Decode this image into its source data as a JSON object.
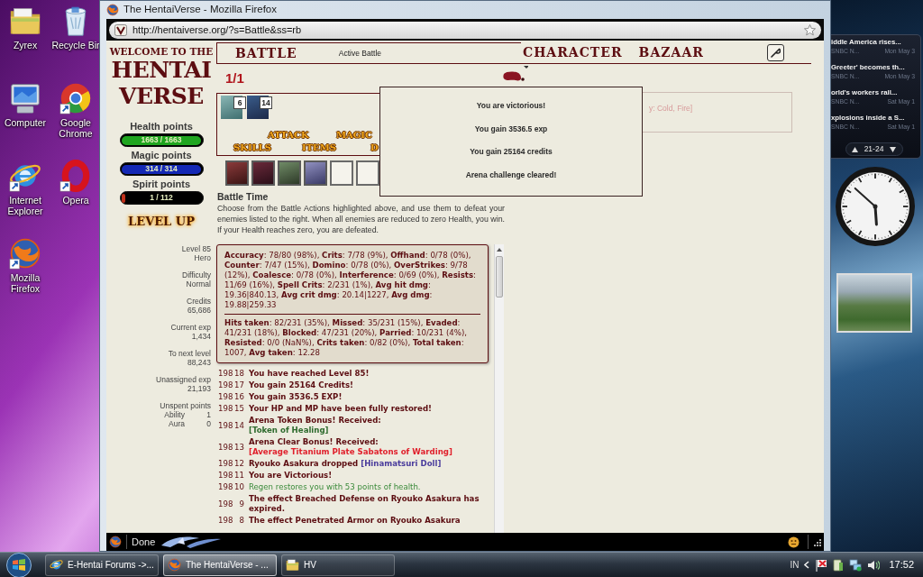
{
  "desktop": {
    "icons": [
      {
        "kind": "folder",
        "label": "Zyrex",
        "shortcut": false
      },
      {
        "kind": "recycle-bin",
        "label": "Recycle Bir",
        "shortcut": false
      },
      {
        "kind": "computer",
        "label": "Computer",
        "shortcut": false
      },
      {
        "kind": "chrome",
        "label": "Google Chrome",
        "shortcut": true
      },
      {
        "kind": "ie",
        "label": "Internet Explorer",
        "shortcut": true
      },
      {
        "kind": "opera",
        "label": "Opera",
        "shortcut": true
      },
      {
        "kind": "firefox",
        "label": "Mozilla Firefox",
        "shortcut": true
      }
    ]
  },
  "browser": {
    "title": "The HentaiVerse - Mozilla Firefox",
    "url": "http://hentaiverse.org/?s=Battle&ss=rb",
    "status": "Done"
  },
  "game": {
    "welcome": "WELCOME TO THE",
    "logo": [
      "HENTAI",
      "VERSE"
    ],
    "bars": [
      {
        "label": "Health points",
        "reading": "1663 / 1663",
        "level": 1,
        "color": "#1fa51f"
      },
      {
        "label": "Magic points",
        "reading": "314 / 314",
        "level": 1,
        "color": "#1428b4"
      },
      {
        "label": "Spirit points",
        "reading": "1 / 112",
        "level": 0.01,
        "color": "#c0301a"
      }
    ],
    "level_up": "LEVEL UP",
    "stats": [
      {
        "label": "Level 85",
        "value": "Hero"
      },
      {
        "label": "Difficulty",
        "value": "Normal"
      },
      {
        "label": "Credits",
        "value": "65,686"
      },
      {
        "label": "Current exp",
        "value": "1,434"
      },
      {
        "label": "To next level",
        "value": "88,243"
      },
      {
        "label": "Unassigned exp",
        "value": "21,193"
      }
    ],
    "unspent": {
      "label": "Unspent points",
      "rows": [
        {
          "label": "Ability",
          "value": "1"
        },
        {
          "label": "Aura",
          "value": "0"
        }
      ]
    },
    "header": {
      "section": "BATTLE",
      "subtitle": "Active Battle",
      "nav": [
        "CHARACTER",
        "BAZAAR"
      ]
    },
    "round": "1/1",
    "effects": [
      {
        "turns": "6"
      },
      {
        "turns": "14"
      }
    ],
    "action_rows": [
      [
        "ATTACK",
        "MAGIC"
      ],
      [
        "SKILLS",
        "ITEMS",
        "D"
      ]
    ],
    "monsters": [
      {
        "kind": "portrait"
      },
      {
        "kind": "portrait"
      },
      {
        "kind": "portrait"
      },
      {
        "kind": "portrait"
      },
      {
        "kind": "empty"
      },
      {
        "kind": "empty"
      }
    ],
    "info": {
      "title": "Battle Time",
      "text": "Choose from the Battle Actions highlighted above, and use them to defeat your enemies listed to the right. When all enemies are reduced to zero Health, you win. If your Health reaches zero, you are defeated."
    },
    "combat_stats": [
      "**Accuracy**: 78/80 (98%), **Crits**: 7/78 (9%), **Offhand**: 0/78 (0%), **Counter**: 7/47 (15%), **Domino**: 0/78 (0%), **OverStrikes**: 9/78 (12%), **Coalesce**: 0/78 (0%), **Interference**: 0/69 (0%), **Resists**: 11/69 (16%), **Spell Crits**: 2/231 (1%), **Avg hit dmg**: 19.36|840.13, **Avg crit dmg**: 20.14|1227, **Avg dmg**: 19.88|259.33",
      "**Hits taken**: 82/231 (35%), **Missed**: 35/231 (15%), **Evaded**: 41/231 (18%), **Blocked**: 47/231 (20%), **Parried**: 10/231 (4%), **Resisted**: 0/0 (NaN%), **Crits taken**: 0/82 (0%), **Total taken**: 1007, **Avg taken**: 12.28"
    ],
    "log": [
      {
        "turn": "198",
        "step": "18",
        "kind": "plain",
        "text": "You have reached Level 85!"
      },
      {
        "turn": "198",
        "step": "17",
        "kind": "plain",
        "text": "You gain 25164 Credits!"
      },
      {
        "turn": "198",
        "step": "16",
        "kind": "plain",
        "text": "You gain 3536.5 EXP!"
      },
      {
        "turn": "198",
        "step": "15",
        "kind": "plain",
        "text": "Your HP and MP have been fully restored!"
      },
      {
        "turn": "198",
        "step": "14",
        "kind": "bonus",
        "text": "Arena Token Bonus! Received:",
        "item": {
          "name": "[Token of Healing]",
          "color": "#2e6b2e"
        }
      },
      {
        "turn": "198",
        "step": "13",
        "kind": "bonus",
        "text": "Arena Clear Bonus! Received:",
        "item": {
          "name": "[Average Titanium Plate Sabatons of Warding]",
          "color": "#e0202c"
        }
      },
      {
        "turn": "198",
        "step": "12",
        "kind": "drop",
        "text": "Ryouko Asakura dropped",
        "item": {
          "name": "[Hinamatsuri Doll]",
          "color": "#4a3c9c"
        }
      },
      {
        "turn": "198",
        "step": "11",
        "kind": "plain",
        "text": "You are Victorious!"
      },
      {
        "turn": "198",
        "step": "10",
        "kind": "regen",
        "text": "Regen restores you with 53 points of health."
      },
      {
        "turn": "198",
        "step": "9",
        "kind": "plain",
        "text": "The effect Breached Defense on Ryouko Asakura has expired."
      },
      {
        "turn": "198",
        "step": "8",
        "kind": "plain",
        "text": "The effect Penetrated Armor on Ryouko Asakura"
      }
    ],
    "victory_popup": {
      "lines": [
        "You are victorious!",
        "You gain 3536.5 exp",
        "You gain 25164 credits",
        "Arena challenge cleared!"
      ]
    },
    "enemy_panel": {
      "text": "y: Cold, Fire]"
    }
  },
  "gadgets": {
    "news": {
      "items": [
        {
          "headline": "iddle America rises...",
          "source": "SNBC N...",
          "date": "Mon May 3"
        },
        {
          "headline": "Greeter' becomes th...",
          "source": "SNBC N...",
          "date": "Mon May 3"
        },
        {
          "headline": "orld's workers rall...",
          "source": "SNBC N...",
          "date": "Sat May 1"
        },
        {
          "headline": "xplosions inside a S...",
          "source": "SNBC N...",
          "date": "Sat May 1"
        }
      ],
      "pager": "21-24"
    }
  },
  "taskbar": {
    "tasks": [
      {
        "kind": "ie",
        "label": "E-Hentai Forums ->...",
        "selected": false
      },
      {
        "kind": "firefox",
        "label": "The HentaiVerse - ...",
        "selected": true
      },
      {
        "kind": "folder",
        "label": "HV",
        "selected": false
      }
    ],
    "language": "IN",
    "time": "17:52"
  }
}
